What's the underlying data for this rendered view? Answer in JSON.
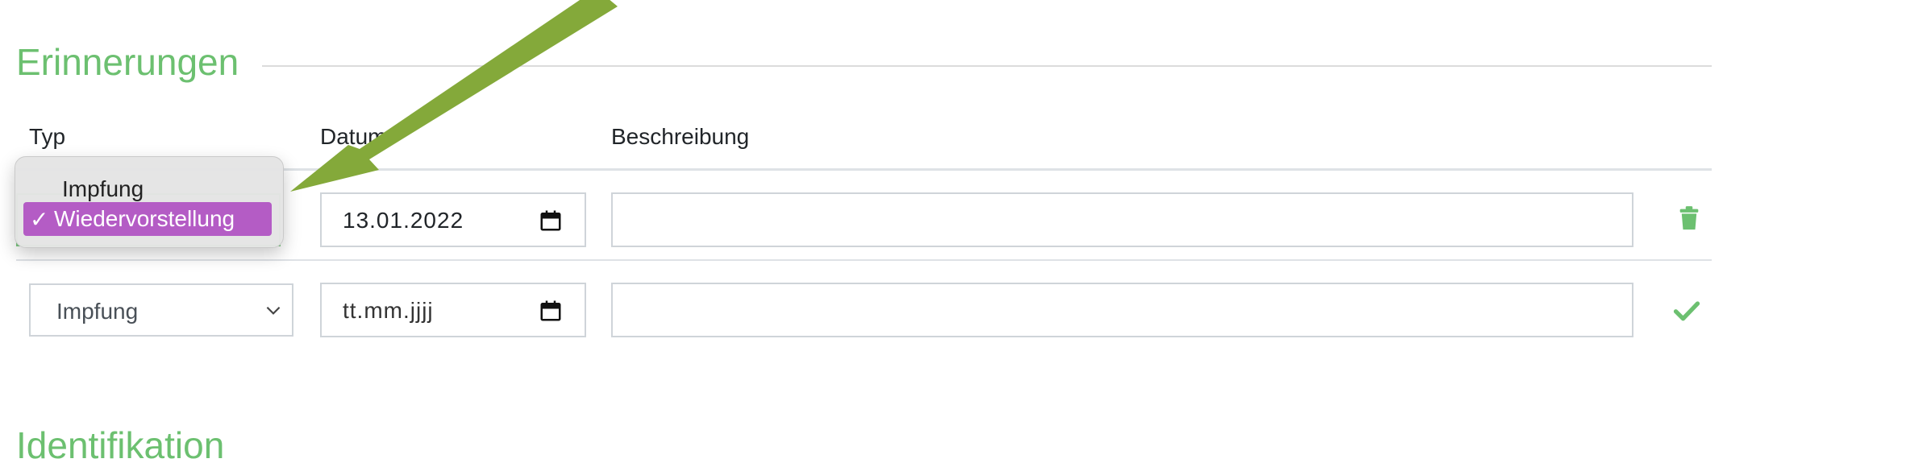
{
  "section": {
    "title": "Erinnerungen"
  },
  "columns": {
    "type": "Typ",
    "date": "Datum",
    "description": "Beschreibung"
  },
  "rows": [
    {
      "type": "Wiedervorstellung",
      "date": "13.01.2022",
      "description": "",
      "action_icon": "trash-icon"
    },
    {
      "type": "Impfung",
      "date_placeholder": "tt.mm.jjjj",
      "description": "",
      "action_icon": "check-icon"
    }
  ],
  "dropdown": {
    "options": [
      "Impfung",
      "Wiedervorstellung"
    ],
    "selected": "Wiedervorstellung",
    "selected_mark": "✓"
  },
  "next_section": {
    "title": "Identifikation"
  },
  "colors": {
    "accent_green": "#6cc070",
    "selection_purple": "#b45cc5",
    "annotation_arrow": "#84a93a"
  }
}
